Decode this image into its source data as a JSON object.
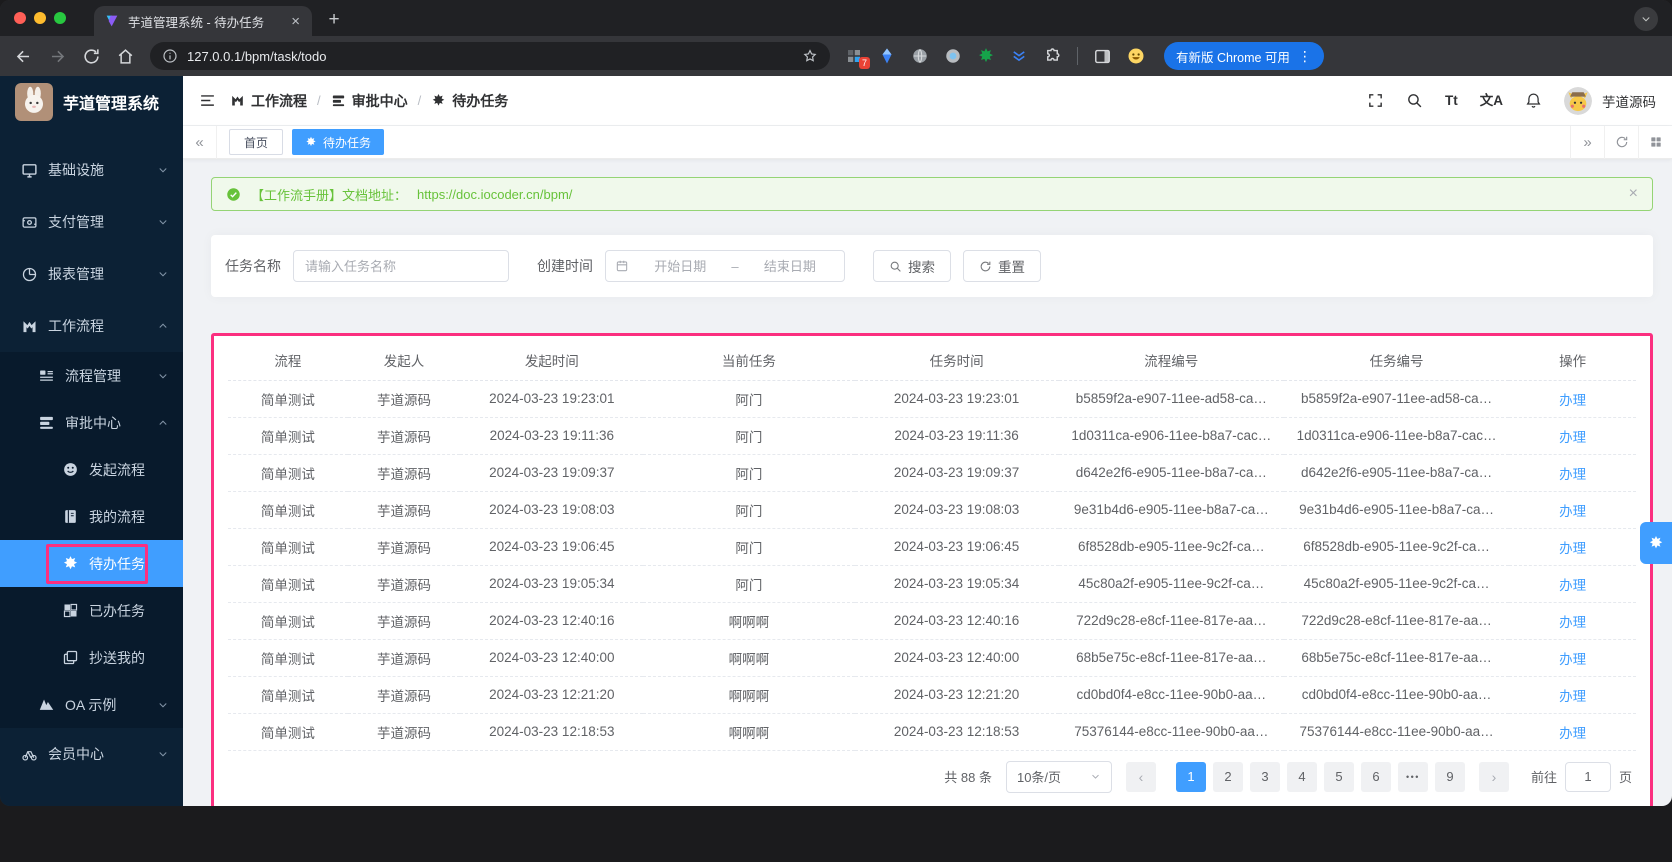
{
  "browser": {
    "tab_title": "芋道管理系统 - 待办任务",
    "url": "127.0.0.1/bpm/task/todo",
    "extension_badge": "7",
    "update_button_label": "有新版 Chrome 可用"
  },
  "sidebar": {
    "app_title": "芋道管理系统",
    "items": [
      {
        "id": "infrastructure",
        "level": 1,
        "icon": "monitor",
        "label": "基础设施",
        "chevron": "down"
      },
      {
        "id": "payment-management",
        "level": 1,
        "icon": "payment",
        "label": "支付管理",
        "chevron": "down"
      },
      {
        "id": "report-management",
        "level": 1,
        "icon": "pie",
        "label": "报表管理",
        "chevron": "down"
      },
      {
        "id": "workflow",
        "level": 1,
        "icon": "workflow",
        "label": "工作流程",
        "chevron": "up"
      },
      {
        "id": "process-management",
        "level": 2,
        "icon": "process",
        "label": "流程管理",
        "chevron": "down",
        "sub": true
      },
      {
        "id": "approval-center",
        "level": 2,
        "icon": "approval",
        "label": "审批中心",
        "chevron": "up",
        "sub": true
      },
      {
        "id": "initiate-process",
        "level": 3,
        "icon": "smile",
        "label": "发起流程",
        "sub": true
      },
      {
        "id": "my-process",
        "level": 3,
        "icon": "book",
        "label": "我的流程",
        "sub": true
      },
      {
        "id": "todo-tasks",
        "level": 3,
        "icon": "gear",
        "label": "待办任务",
        "sub": true,
        "active": true,
        "annotated": true
      },
      {
        "id": "done-tasks",
        "level": 3,
        "icon": "grid",
        "label": "已办任务",
        "sub": true
      },
      {
        "id": "cc-to-me",
        "level": 3,
        "icon": "copy",
        "label": "抄送我的",
        "sub": true
      },
      {
        "id": "oa-example",
        "level": 2,
        "icon": "oa",
        "label": "OA 示例",
        "chevron": "down",
        "sub": true
      },
      {
        "id": "member-center",
        "level": 1,
        "icon": "member",
        "label": "会员中心",
        "chevron": "down"
      }
    ]
  },
  "header": {
    "breadcrumb": [
      {
        "icon": "workflow",
        "label": "工作流程"
      },
      {
        "icon": "approval",
        "label": "审批中心"
      },
      {
        "icon": "gear",
        "label": "待办任务"
      }
    ],
    "font_icon_label": "Tt",
    "locale_icon_label": "文A",
    "username": "芋道源码"
  },
  "tags": {
    "tabs": [
      {
        "label": "首页"
      },
      {
        "label": "待办任务"
      }
    ]
  },
  "alert": {
    "text": "【工作流手册】文档地址：",
    "link": "https://doc.iocoder.cn/bpm/"
  },
  "filter": {
    "task_name_label": "任务名称",
    "task_name_placeholder": "请输入任务名称",
    "create_time_label": "创建时间",
    "start_date_placeholder": "开始日期",
    "range_separator": "–",
    "end_date_placeholder": "结束日期",
    "search_label": "搜索",
    "reset_label": "重置"
  },
  "table": {
    "headers": [
      "流程",
      "发起人",
      "发起时间",
      "当前任务",
      "任务时间",
      "流程编号",
      "任务编号",
      "操作"
    ],
    "action_label": "办理",
    "rows": [
      [
        "简单测试",
        "芋道源码",
        "2024-03-23 19:23:01",
        "阿门",
        "2024-03-23 19:23:01",
        "b5859f2a-e907-11ee-ad58-ca…",
        "b5859f2a-e907-11ee-ad58-ca…"
      ],
      [
        "简单测试",
        "芋道源码",
        "2024-03-23 19:11:36",
        "阿门",
        "2024-03-23 19:11:36",
        "1d0311ca-e906-11ee-b8a7-cac…",
        "1d0311ca-e906-11ee-b8a7-cac…"
      ],
      [
        "简单测试",
        "芋道源码",
        "2024-03-23 19:09:37",
        "阿门",
        "2024-03-23 19:09:37",
        "d642e2f6-e905-11ee-b8a7-ca…",
        "d642e2f6-e905-11ee-b8a7-ca…"
      ],
      [
        "简单测试",
        "芋道源码",
        "2024-03-23 19:08:03",
        "阿门",
        "2024-03-23 19:08:03",
        "9e31b4d6-e905-11ee-b8a7-ca…",
        "9e31b4d6-e905-11ee-b8a7-ca…"
      ],
      [
        "简单测试",
        "芋道源码",
        "2024-03-23 19:06:45",
        "阿门",
        "2024-03-23 19:06:45",
        "6f8528db-e905-11ee-9c2f-ca…",
        "6f8528db-e905-11ee-9c2f-ca…"
      ],
      [
        "简单测试",
        "芋道源码",
        "2024-03-23 19:05:34",
        "阿门",
        "2024-03-23 19:05:34",
        "45c80a2f-e905-11ee-9c2f-ca…",
        "45c80a2f-e905-11ee-9c2f-ca…"
      ],
      [
        "简单测试",
        "芋道源码",
        "2024-03-23 12:40:16",
        "啊啊啊",
        "2024-03-23 12:40:16",
        "722d9c28-e8cf-11ee-817e-aa…",
        "722d9c28-e8cf-11ee-817e-aa…"
      ],
      [
        "简单测试",
        "芋道源码",
        "2024-03-23 12:40:00",
        "啊啊啊",
        "2024-03-23 12:40:00",
        "68b5e75c-e8cf-11ee-817e-aa…",
        "68b5e75c-e8cf-11ee-817e-aa…"
      ],
      [
        "简单测试",
        "芋道源码",
        "2024-03-23 12:21:20",
        "啊啊啊",
        "2024-03-23 12:21:20",
        "cd0bd0f4-e8cc-11ee-90b0-aa…",
        "cd0bd0f4-e8cc-11ee-90b0-aa…"
      ],
      [
        "简单测试",
        "芋道源码",
        "2024-03-23 12:18:53",
        "啊啊啊",
        "2024-03-23 12:18:53",
        "75376144-e8cc-11ee-90b0-aa…",
        "75376144-e8cc-11ee-90b0-aa…"
      ]
    ]
  },
  "pagination": {
    "total_label": "共 88 条",
    "page_size_label": "10条/页",
    "pages": [
      "1",
      "2",
      "3",
      "4",
      "5",
      "6",
      "•••",
      "9"
    ],
    "active_page": "1",
    "goto_label": "前往",
    "goto_value": "1",
    "goto_unit_label": "页"
  }
}
